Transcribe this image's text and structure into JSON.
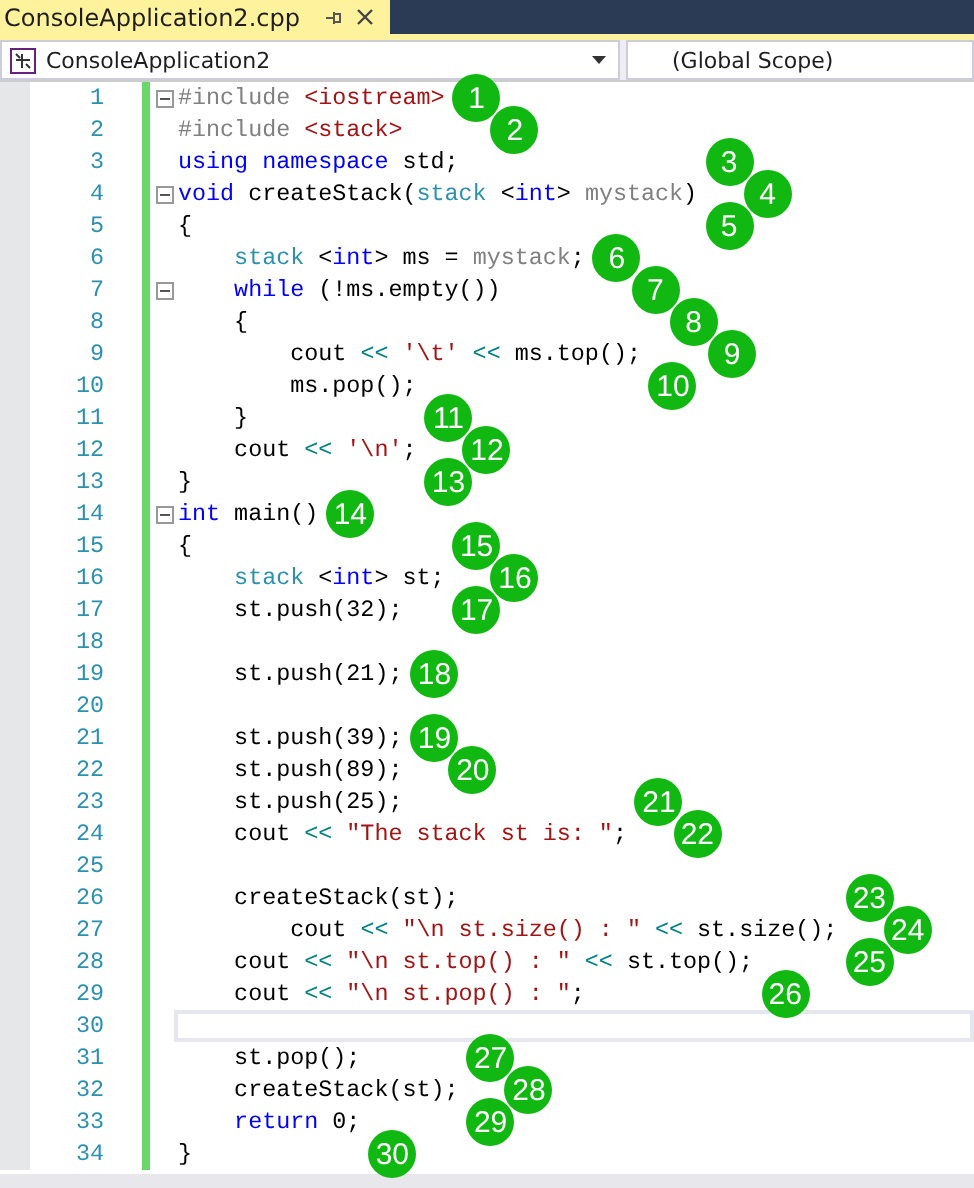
{
  "tab": {
    "title": "ConsoleApplication2.cpp",
    "selected": true
  },
  "navigation": {
    "project": "ConsoleApplication2",
    "scope": "(Global Scope)"
  },
  "lines": [
    {
      "number": "1",
      "foldable": true,
      "current": false,
      "tokens": [
        {
          "text": "#include",
          "kind": "preprocessor"
        },
        {
          "text": " <iostream>",
          "kind": "string"
        }
      ]
    },
    {
      "number": "2",
      "foldable": false,
      "current": false,
      "tokens": [
        {
          "text": "#include",
          "kind": "preprocessor"
        },
        {
          "text": " <stack>",
          "kind": "string"
        }
      ]
    },
    {
      "number": "3",
      "foldable": false,
      "current": false,
      "tokens": [
        {
          "text": "using namespace",
          "kind": "keyword"
        },
        {
          "text": " std;",
          "kind": "plain"
        }
      ]
    },
    {
      "number": "4",
      "foldable": true,
      "current": false,
      "tokens": [
        {
          "text": "void",
          "kind": "keyword"
        },
        {
          "text": " createStack(",
          "kind": "plain"
        },
        {
          "text": "stack",
          "kind": "type"
        },
        {
          "text": " <",
          "kind": "plain"
        },
        {
          "text": "int",
          "kind": "keyword"
        },
        {
          "text": "> ",
          "kind": "plain"
        },
        {
          "text": "mystack",
          "kind": "parameter"
        },
        {
          "text": ")",
          "kind": "plain"
        }
      ]
    },
    {
      "number": "5",
      "foldable": false,
      "current": false,
      "tokens": [
        {
          "text": "{",
          "kind": "plain"
        }
      ]
    },
    {
      "number": "6",
      "foldable": false,
      "current": false,
      "tokens": [
        {
          "text": "    stack",
          "kind": "type"
        },
        {
          "text": " <",
          "kind": "plain"
        },
        {
          "text": "int",
          "kind": "keyword"
        },
        {
          "text": "> ms = ",
          "kind": "plain"
        },
        {
          "text": "mystack",
          "kind": "parameter"
        },
        {
          "text": ";",
          "kind": "plain"
        }
      ]
    },
    {
      "number": "7",
      "foldable": true,
      "current": false,
      "tokens": [
        {
          "text": "    while",
          "kind": "keyword"
        },
        {
          "text": " (!ms.empty())",
          "kind": "plain"
        }
      ]
    },
    {
      "number": "8",
      "foldable": false,
      "current": false,
      "tokens": [
        {
          "text": "    {",
          "kind": "plain"
        }
      ]
    },
    {
      "number": "9",
      "foldable": false,
      "current": false,
      "tokens": [
        {
          "text": "        cout ",
          "kind": "plain"
        },
        {
          "text": "<<",
          "kind": "operator"
        },
        {
          "text": " '\\t'",
          "kind": "string"
        },
        {
          "text": " <<",
          "kind": "operator"
        },
        {
          "text": " ms.top();",
          "kind": "plain"
        }
      ]
    },
    {
      "number": "10",
      "foldable": false,
      "current": false,
      "tokens": [
        {
          "text": "        ms.pop();",
          "kind": "plain"
        }
      ]
    },
    {
      "number": "11",
      "foldable": false,
      "current": false,
      "tokens": [
        {
          "text": "    }",
          "kind": "plain"
        }
      ]
    },
    {
      "number": "12",
      "foldable": false,
      "current": false,
      "tokens": [
        {
          "text": "    cout ",
          "kind": "plain"
        },
        {
          "text": "<<",
          "kind": "operator"
        },
        {
          "text": " '\\n'",
          "kind": "string"
        },
        {
          "text": ";",
          "kind": "plain"
        }
      ]
    },
    {
      "number": "13",
      "foldable": false,
      "current": false,
      "tokens": [
        {
          "text": "}",
          "kind": "plain"
        }
      ]
    },
    {
      "number": "14",
      "foldable": true,
      "current": false,
      "tokens": [
        {
          "text": "int",
          "kind": "keyword"
        },
        {
          "text": " main()",
          "kind": "plain"
        }
      ]
    },
    {
      "number": "15",
      "foldable": false,
      "current": false,
      "tokens": [
        {
          "text": "{",
          "kind": "plain"
        }
      ]
    },
    {
      "number": "16",
      "foldable": false,
      "current": false,
      "tokens": [
        {
          "text": "    stack",
          "kind": "type"
        },
        {
          "text": " <",
          "kind": "plain"
        },
        {
          "text": "int",
          "kind": "keyword"
        },
        {
          "text": "> st;",
          "kind": "plain"
        }
      ]
    },
    {
      "number": "17",
      "foldable": false,
      "current": false,
      "tokens": [
        {
          "text": "    st.push(32);",
          "kind": "plain"
        }
      ]
    },
    {
      "number": "18",
      "foldable": false,
      "current": false
    },
    {
      "number": "19",
      "foldable": false,
      "current": false,
      "tokens": [
        {
          "text": "    st.push(21);",
          "kind": "plain"
        }
      ]
    },
    {
      "number": "20",
      "foldable": false,
      "current": false
    },
    {
      "number": "21",
      "foldable": false,
      "current": false,
      "tokens": [
        {
          "text": "    st.push(39);",
          "kind": "plain"
        }
      ]
    },
    {
      "number": "22",
      "foldable": false,
      "current": false,
      "tokens": [
        {
          "text": "    st.push(89);",
          "kind": "plain"
        }
      ]
    },
    {
      "number": "23",
      "foldable": false,
      "current": false,
      "tokens": [
        {
          "text": "    st.push(25);",
          "kind": "plain"
        }
      ]
    },
    {
      "number": "24",
      "foldable": false,
      "current": false,
      "tokens": [
        {
          "text": "    cout ",
          "kind": "plain"
        },
        {
          "text": "<<",
          "kind": "operator"
        },
        {
          "text": " \"The stack st is: \"",
          "kind": "string"
        },
        {
          "text": ";",
          "kind": "plain"
        }
      ]
    },
    {
      "number": "25",
      "foldable": false,
      "current": false
    },
    {
      "number": "26",
      "foldable": false,
      "current": false,
      "tokens": [
        {
          "text": "    createStack(st);",
          "kind": "plain"
        }
      ]
    },
    {
      "number": "27",
      "foldable": false,
      "current": false,
      "tokens": [
        {
          "text": "        cout ",
          "kind": "plain"
        },
        {
          "text": "<<",
          "kind": "operator"
        },
        {
          "text": " \"\\n st.size() : \"",
          "kind": "string"
        },
        {
          "text": " <<",
          "kind": "operator"
        },
        {
          "text": " st.size();",
          "kind": "plain"
        }
      ]
    },
    {
      "number": "28",
      "foldable": false,
      "current": false,
      "tokens": [
        {
          "text": "    cout ",
          "kind": "plain"
        },
        {
          "text": "<<",
          "kind": "operator"
        },
        {
          "text": " \"\\n st.top() : \"",
          "kind": "string"
        },
        {
          "text": " <<",
          "kind": "operator"
        },
        {
          "text": " st.top();",
          "kind": "plain"
        }
      ]
    },
    {
      "number": "29",
      "foldable": false,
      "current": false,
      "tokens": [
        {
          "text": "    cout ",
          "kind": "plain"
        },
        {
          "text": "<<",
          "kind": "operator"
        },
        {
          "text": " \"\\n st.pop() : \"",
          "kind": "string"
        },
        {
          "text": ";",
          "kind": "plain"
        }
      ]
    },
    {
      "number": "30",
      "foldable": false,
      "current": true
    },
    {
      "number": "31",
      "foldable": false,
      "current": false,
      "tokens": [
        {
          "text": "    st.pop();",
          "kind": "plain"
        }
      ]
    },
    {
      "number": "32",
      "foldable": false,
      "current": false,
      "tokens": [
        {
          "text": "    createStack(st);",
          "kind": "plain"
        }
      ]
    },
    {
      "number": "33",
      "foldable": false,
      "current": false,
      "tokens": [
        {
          "text": "    return",
          "kind": "keyword"
        },
        {
          "text": " 0;",
          "kind": "plain"
        }
      ]
    },
    {
      "number": "34",
      "foldable": false,
      "current": false,
      "tokens": [
        {
          "text": "}",
          "kind": "plain"
        }
      ]
    }
  ],
  "annotations": [
    "1",
    "2",
    "3",
    "4",
    "5",
    "6",
    "7",
    "8",
    "9",
    "10",
    "11",
    "12",
    "13",
    "14",
    "15",
    "16",
    "17",
    "18",
    "19",
    "20",
    "21",
    "22",
    "23",
    "24",
    "25",
    "26",
    "27",
    "28",
    "29",
    "30"
  ]
}
